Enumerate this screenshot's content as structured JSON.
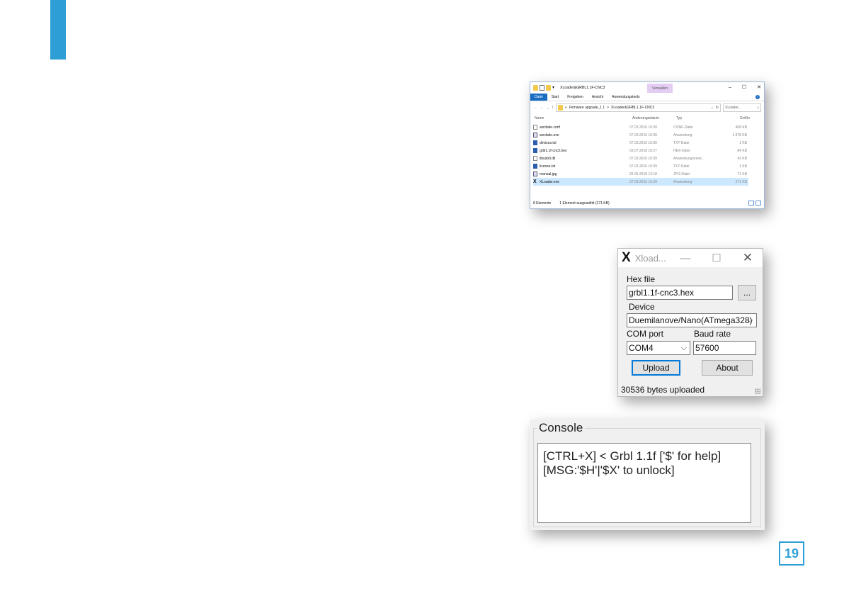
{
  "explorer": {
    "title": "XLoader&GRBL1.1F-CNC3",
    "context_tab": "Verwalten",
    "ribbon_tabs": [
      "Datei",
      "Start",
      "Freigeben",
      "Ansicht",
      "Anwendungstools"
    ],
    "address": {
      "prefix": "«",
      "path1": "Firmware upgrade_1.1",
      "sep": ">",
      "path2": "XLoader&GRBL1.1F-CNC3",
      "search_placeholder": "XLoader..."
    },
    "columns": [
      "Name",
      "Änderungsdatum",
      "Typ",
      "Größe"
    ],
    "files": [
      {
        "name": "avrdude.conf",
        "date": "07.03.2016 16:39",
        "type": "CONF-Datei",
        "size": "408 KB",
        "icon": "file-icon"
      },
      {
        "name": "avrdude.exe",
        "date": "07.03.2016 16:39",
        "type": "Anwendung",
        "size": "1.878 KB",
        "icon": "exe-icon"
      },
      {
        "name": "devices.txt",
        "date": "07.03.2016 16:39",
        "type": "TXT-Datei",
        "size": "1 KB",
        "icon": "hex-icon"
      },
      {
        "name": "grbl1.1f-cnc3.hex",
        "date": "03.07.2018 16:27",
        "type": "HEX-Datei",
        "size": "84 KB",
        "icon": "hex-icon"
      },
      {
        "name": "libusb0.dll",
        "date": "07.03.2016 16:39",
        "type": "Anwendungserwe...",
        "size": "43 KB",
        "icon": "file-icon"
      },
      {
        "name": "license.txt",
        "date": "07.03.2016 16:39",
        "type": "TXT-Datei",
        "size": "1 KB",
        "icon": "hex-icon"
      },
      {
        "name": "manual.jpg",
        "date": "26.06.2018 12:18",
        "type": "JPG-Datei",
        "size": "71 KB",
        "icon": "exe-icon"
      },
      {
        "name": "XLoader.exe",
        "date": "07.03.2016 16:39",
        "type": "Anwendung",
        "size": "271 KB",
        "icon": "xloader-icon"
      }
    ],
    "status_count": "8 Elemente",
    "status_selected": "1 Element ausgewählt (271 KB)"
  },
  "xloader": {
    "logo": "X",
    "title": "Xload...",
    "hex_label": "Hex file",
    "hex_value": "grbl1.1f-cnc3.hex",
    "browse_label": "...",
    "device_label": "Device",
    "device_value": "Duemilanove/Nano(ATmega328)",
    "com_label": "COM port",
    "com_value": "COM4",
    "baud_label": "Baud rate",
    "baud_value": "57600",
    "upload_label": "Upload",
    "about_label": "About",
    "status": "30536 bytes uploaded"
  },
  "console": {
    "legend": "Console",
    "lines": "[CTRL+X] < Grbl 1.1f ['$' for help]\n[MSG:'$H'|'$X' to unlock]"
  },
  "page_number": "19",
  "colors": {
    "accent": "#2e9fd6",
    "selection": "#cce8ff",
    "file_tab": "#1a6ec2"
  }
}
